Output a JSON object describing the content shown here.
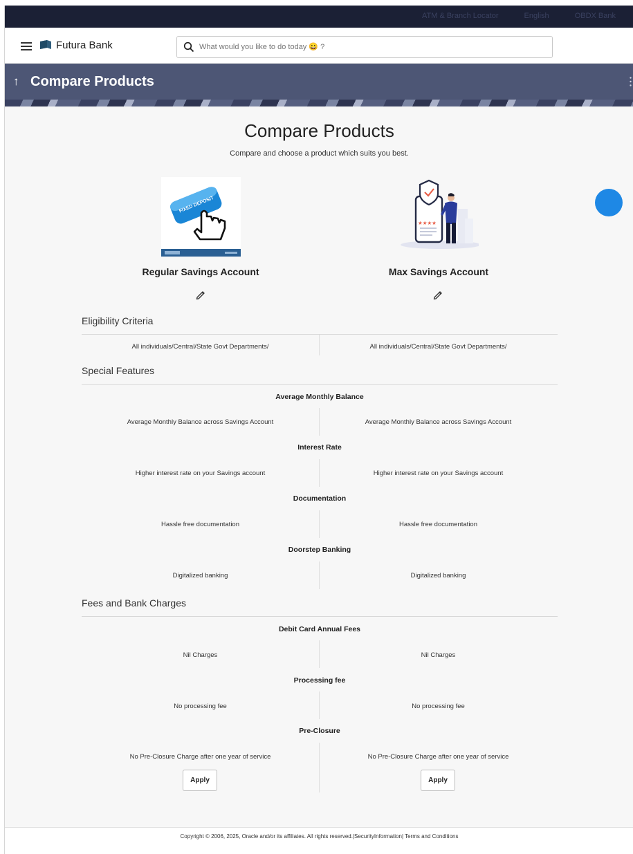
{
  "topbar": {
    "location_link": "ATM & Branch Locator",
    "language": "English",
    "user": "OBDX Bank"
  },
  "header": {
    "brand": "Futura Bank",
    "search_placeholder": "What would you like to do today 😀 ?"
  },
  "banner": {
    "title": "Compare Products"
  },
  "page": {
    "title": "Compare Products",
    "subtitle": "Compare and choose a product which suits you best."
  },
  "products": [
    {
      "name": "Regular Savings Account",
      "image_text": "FIXED DEPOSIT"
    },
    {
      "name": "Max Savings Account"
    }
  ],
  "sections": {
    "eligibility": {
      "title": "Eligibility Criteria",
      "values": [
        "All individuals/Central/State Govt Departments/",
        "All individuals/Central/State Govt Departments/"
      ]
    },
    "special": {
      "title": "Special Features",
      "features": [
        {
          "label": "Average Monthly Balance",
          "values": [
            "Average Monthly Balance across Savings Account",
            "Average Monthly Balance across Savings Account"
          ]
        },
        {
          "label": "Interest Rate",
          "values": [
            "Higher interest rate on your Savings account",
            "Higher interest rate on your Savings account"
          ]
        },
        {
          "label": "Documentation",
          "values": [
            "Hassle free documentation",
            "Hassle free documentation"
          ]
        },
        {
          "label": "Doorstep Banking",
          "values": [
            "Digitalized banking",
            "Digitalized banking"
          ]
        }
      ]
    },
    "fees": {
      "title": "Fees and Bank Charges",
      "features": [
        {
          "label": "Debit Card Annual Fees",
          "values": [
            "Nil Charges",
            "Nil Charges"
          ]
        },
        {
          "label": "Processing fee",
          "values": [
            "No processing fee",
            "No processing fee"
          ]
        },
        {
          "label": "Pre-Closure",
          "values": [
            "No Pre-Closure Charge after one year of service",
            "No Pre-Closure Charge after one year of service"
          ]
        }
      ]
    }
  },
  "actions": {
    "apply_label": "Apply"
  },
  "footer": {
    "text": "Copyright © 2006, 2025, Oracle and/or its affiliates. All rights reserved.|SecurityInformation| Terms and Conditions"
  },
  "colors": {
    "topbar": "#1b2035",
    "banner": "#4d5675",
    "accent": "#1e88e5"
  }
}
